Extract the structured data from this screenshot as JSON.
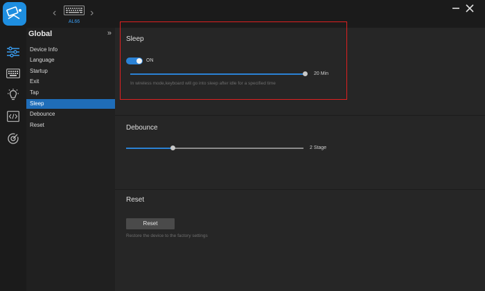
{
  "device": {
    "name": "AL66"
  },
  "window": {
    "minimize_icon": "minus-icon",
    "close_icon": "close-icon"
  },
  "iconbar": [
    {
      "name": "sliders-icon",
      "active": true
    },
    {
      "name": "keyboard-icon"
    },
    {
      "name": "bulb-icon"
    },
    {
      "name": "code-icon"
    },
    {
      "name": "target-icon"
    }
  ],
  "submenu": {
    "title": "Global",
    "collapse_glyph": "»",
    "items": [
      {
        "label": "Device Info"
      },
      {
        "label": "Language"
      },
      {
        "label": "Startup"
      },
      {
        "label": "Exit"
      },
      {
        "label": "Tap"
      },
      {
        "label": "Sleep",
        "active": true
      },
      {
        "label": "Debounce"
      },
      {
        "label": "Reset"
      }
    ]
  },
  "sleep": {
    "title": "Sleep",
    "toggle_label": "ON",
    "toggle_on": true,
    "slider_value_label": "20 Min",
    "slider_fraction": 1.0,
    "hint": "In wireless mode,keyboard will go into sleep after idle for a specified time"
  },
  "debounce": {
    "title": "Debounce",
    "slider_value_label": "2 Stage",
    "slider_fraction": 0.26
  },
  "reset": {
    "title": "Reset",
    "button_label": "Reset",
    "hint": "Restore the device to the factory settings"
  },
  "colors": {
    "accent": "#2b82d6",
    "highlight_border": "#e02020",
    "active_item": "#1f6db8"
  }
}
